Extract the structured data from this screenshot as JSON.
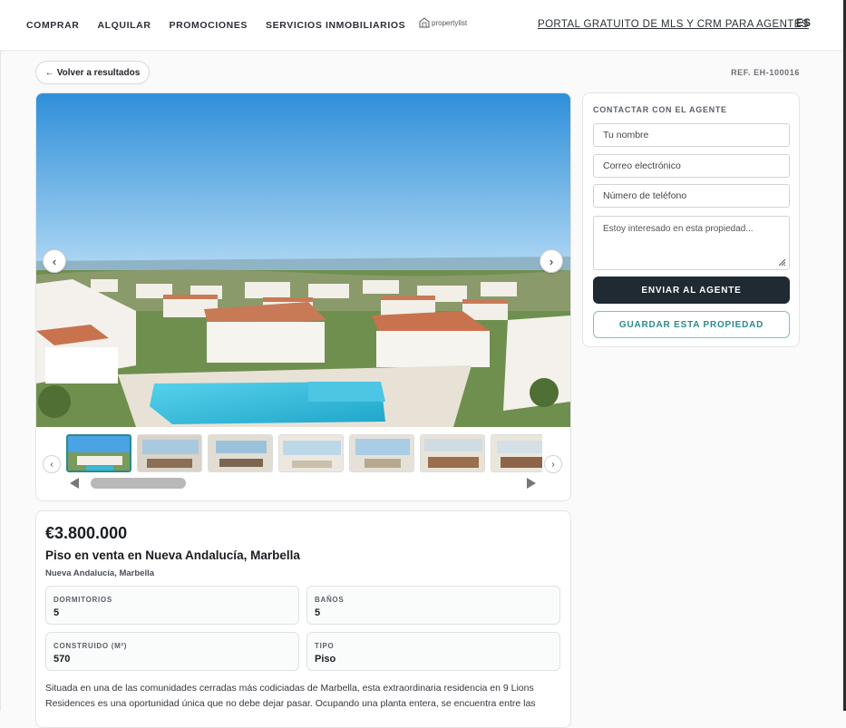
{
  "nav": {
    "items": [
      {
        "label": "COMPRAR"
      },
      {
        "label": "ALQUILAR"
      },
      {
        "label": "PROMOCIONES"
      },
      {
        "label": "SERVICIOS INMOBILIARIOS"
      }
    ],
    "logo_text": "propertylist",
    "portal_link": "PORTAL GRATUITO DE MLS Y CRM PARA AGENTES",
    "language": "ES"
  },
  "toolbar": {
    "back_label": "Volver a resultados",
    "reference": "REF. EH-100016"
  },
  "gallery": {
    "thumbnail_count": 7,
    "active_index": 0
  },
  "contact": {
    "title": "CONTACTAR CON EL AGENTE",
    "name_placeholder": "Tu nombre",
    "email_placeholder": "Correo electrónico",
    "phone_placeholder": "Número de teléfono",
    "message_placeholder": "Estoy interesado en esta propiedad...",
    "send_label": "ENVIAR AL AGENTE",
    "save_label": "GUARDAR ESTA PROPIEDAD"
  },
  "listing": {
    "price": "€3.800.000",
    "title": "Piso en venta en Nueva Andalucía, Marbella",
    "location": "Nueva Andalucía, Marbella",
    "stats": [
      {
        "label": "DORMITORIOS",
        "value": "5"
      },
      {
        "label": "BAÑOS",
        "value": "5"
      },
      {
        "label": "CONSTRUIDO (M²)",
        "value": "570"
      },
      {
        "label": "TIPO",
        "value": "Piso"
      }
    ],
    "description": "Situada en una de las comunidades cerradas más codiciadas de Marbella, esta extraordinaria residencia en 9 Lions Residences es una oportunidad única que no debe dejar pasar. Ocupando una planta entera, se encuentra entre las"
  },
  "colors": {
    "accent": "#2a8a8a",
    "primary_button": "#1f2a33",
    "sky": "#3d9ee0",
    "pool": "#3bb8d8"
  }
}
